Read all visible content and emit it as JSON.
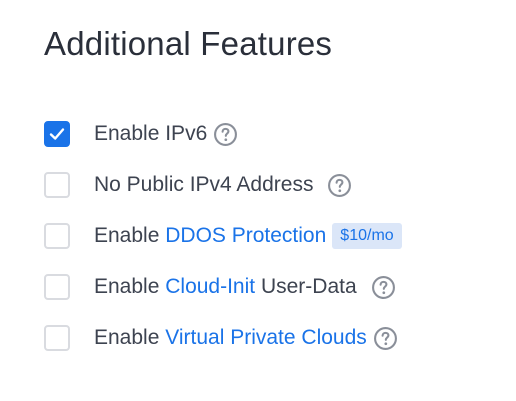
{
  "section": {
    "title": "Additional Features"
  },
  "features": {
    "ipv6": {
      "checked": true,
      "prefix": "Enable IPv6",
      "help_icon": "help-circle-icon"
    },
    "no_public_ipv4": {
      "checked": false,
      "prefix": "No Public IPv4 Address",
      "help_icon": "help-circle-icon"
    },
    "ddos": {
      "checked": false,
      "prefix": "Enable ",
      "link": "DDOS Protection",
      "price_badge": "$10/mo"
    },
    "cloud_init": {
      "checked": false,
      "prefix": "Enable ",
      "link": "Cloud-Init",
      "suffix": " User-Data",
      "help_icon": "help-circle-icon"
    },
    "vpc": {
      "checked": false,
      "prefix": "Enable ",
      "link": "Virtual Private Clouds",
      "help_icon": "help-circle-icon"
    }
  },
  "colors": {
    "accent": "#1a73e8",
    "text": "#3d4350",
    "title": "#2a2f3a",
    "checkbox_border": "#d9dbe0",
    "help_icon": "#8a8f99",
    "badge_bg": "#dbe6f8"
  }
}
